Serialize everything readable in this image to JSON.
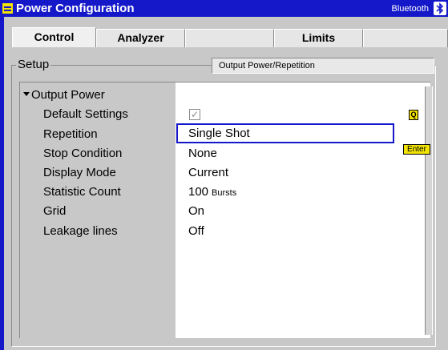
{
  "title_bar": {
    "title": "Power Configuration",
    "right_label": "Bluetooth",
    "icon": "bluetooth-icon"
  },
  "tabs": [
    {
      "label": "Control",
      "active": true
    },
    {
      "label": "Analyzer",
      "active": false
    },
    {
      "label": "",
      "active": false
    },
    {
      "label": "Limits",
      "active": false
    },
    {
      "label": "",
      "active": false
    }
  ],
  "setup": {
    "label": "Setup",
    "header": "Output Power/Repetition",
    "group_title": "Output Power",
    "params": [
      {
        "label": "Default Settings",
        "value": "",
        "checked": true
      },
      {
        "label": "Repetition",
        "value": "Single Shot"
      },
      {
        "label": "Stop Condition",
        "value": "None"
      },
      {
        "label": "Display Mode",
        "value": "Current"
      },
      {
        "label": "Statistic Count",
        "value": "100",
        "unit": "Bursts"
      },
      {
        "label": "Grid",
        "value": "On"
      },
      {
        "label": "Leakage lines",
        "value": "Off"
      }
    ]
  },
  "hints": {
    "q_badge": "Q",
    "enter_badge": "Enter"
  },
  "colors": {
    "title_bar": "#1418c8",
    "highlight": "#f2e400",
    "panel_gray": "#c8c8c8"
  }
}
